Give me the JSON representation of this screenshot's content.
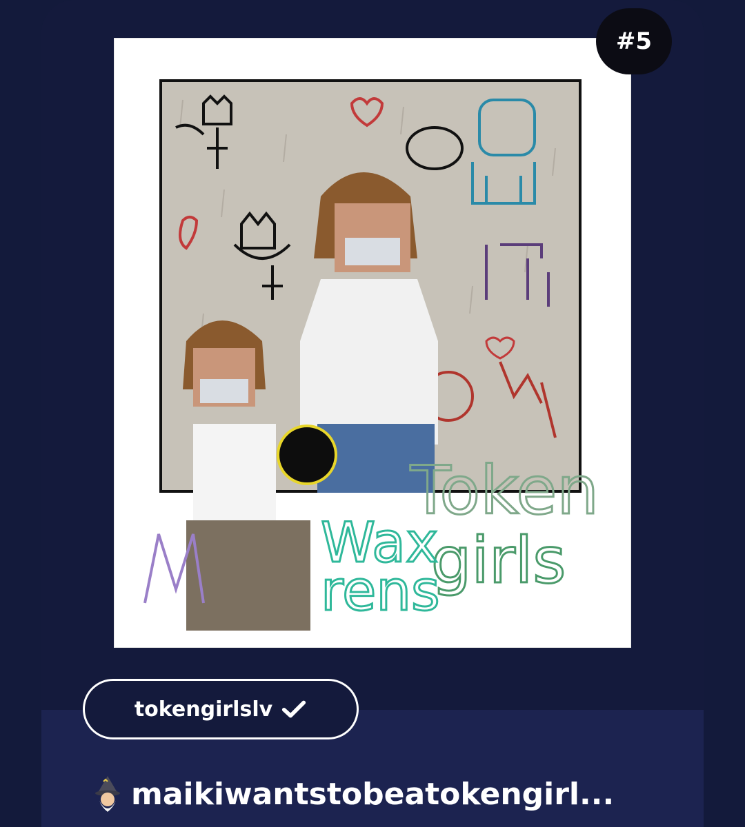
{
  "nft": {
    "rank": "#5",
    "creator": "tokengirlslv",
    "verified": true,
    "title": "maikiwantstobeatokengirl...",
    "title_emoji": "wizard-icon",
    "artwork": {
      "description_words": [
        "Token",
        "girls",
        "Wax",
        "rens"
      ]
    }
  },
  "colors": {
    "background": "#131a3b",
    "card": "#141a3c",
    "card_footer": "#1c2350",
    "badge": "#0c0c14",
    "text": "#ffffff"
  }
}
